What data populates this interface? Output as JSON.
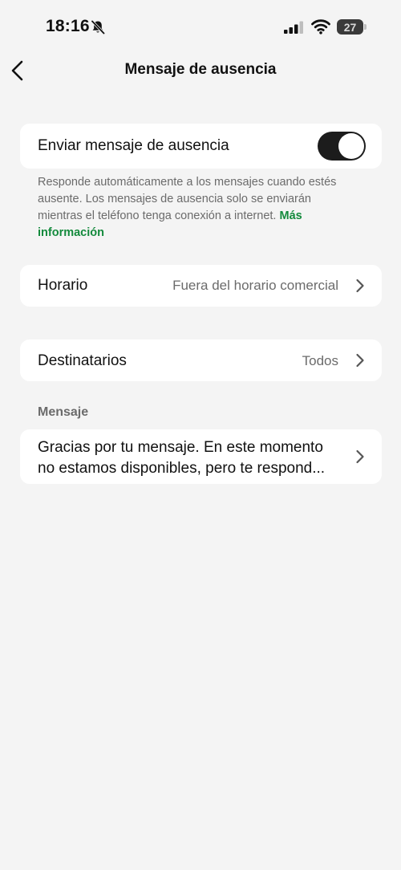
{
  "status_bar": {
    "time": "18:16",
    "battery": "27"
  },
  "nav": {
    "title": "Mensaje de ausencia"
  },
  "toggle_row": {
    "label": "Enviar mensaje de ausencia",
    "enabled": true
  },
  "footnote": {
    "text": "Responde automáticamente a los mensajes cuando estés ausente. Los mensajes de ausencia solo se enviarán mientras el teléfono tenga conexión a internet. ",
    "link": "Más información"
  },
  "schedule_row": {
    "label": "Horario",
    "value": "Fuera del horario comercial"
  },
  "recipients_row": {
    "label": "Destinatarios",
    "value": "Todos"
  },
  "message_section": {
    "header": "Mensaje",
    "line1": "Gracias por tu mensaje. En este momento",
    "line2": "no estamos disponibles, pero te respond..."
  },
  "colors": {
    "background": "#f4f4f4",
    "card": "#ffffff",
    "link": "#138a3c",
    "toggle_on": "#1c1c1c"
  }
}
